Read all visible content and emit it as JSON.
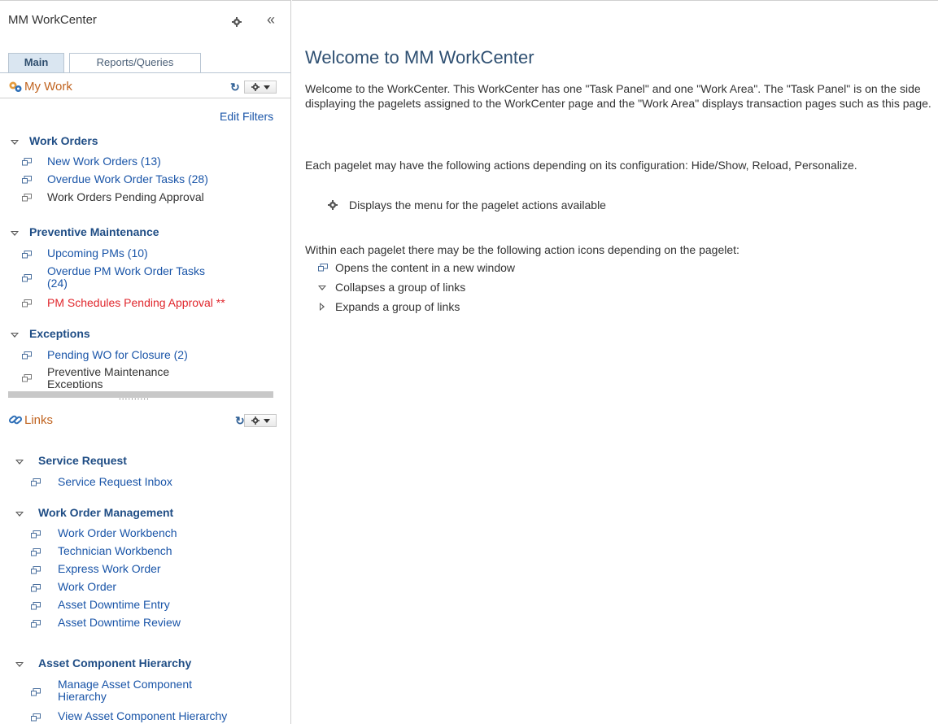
{
  "panel": {
    "title": "MM WorkCenter",
    "collapse_glyph": "«",
    "tabs": [
      {
        "label": "Main",
        "active": true
      },
      {
        "label": "Reports/Queries",
        "active": false
      }
    ]
  },
  "my_work": {
    "title": "My Work",
    "refresh_glyph": "↻",
    "edit_filters": "Edit Filters",
    "groups": [
      {
        "label": "Work Orders",
        "items": [
          {
            "label": "New Work Orders (13)",
            "style": "link"
          },
          {
            "label": "Overdue Work Order Tasks (28)",
            "style": "link"
          },
          {
            "label": "Work Orders Pending Approval",
            "style": "plain"
          }
        ]
      },
      {
        "label": "Preventive Maintenance",
        "items": [
          {
            "label": "Upcoming PMs (10)",
            "style": "link"
          },
          {
            "label": "Overdue PM Work Order Tasks",
            "label2": "(24)",
            "style": "link"
          },
          {
            "label": "PM Schedules Pending Approval **",
            "style": "alert"
          }
        ]
      },
      {
        "label": "Exceptions",
        "items": [
          {
            "label": "Pending WO for Closure (2)",
            "style": "link"
          },
          {
            "label": "Preventive Maintenance",
            "label2": "Exceptions",
            "style": "plain"
          }
        ]
      }
    ]
  },
  "links": {
    "title": "Links",
    "refresh_glyph": "↻",
    "groups": [
      {
        "label": "Service Request",
        "items": [
          "Service Request Inbox"
        ]
      },
      {
        "label": "Work Order Management",
        "items": [
          "Work Order Workbench",
          "Technician Workbench",
          "Express Work Order",
          "Work Order",
          "Asset Downtime Entry",
          "Asset Downtime Review"
        ]
      },
      {
        "label": "Asset Component Hierarchy",
        "items": [
          "Manage Asset Component",
          "View Asset Component Hierarchy"
        ],
        "item1_line2": "Hierarchy"
      }
    ]
  },
  "work_area": {
    "title": "Welcome to MM WorkCenter",
    "para1": "Welcome to the WorkCenter. This WorkCenter has one \"Task Panel\" and one \"Work Area\". The \"Task Panel\" is on the side displaying the pagelets assigned to the WorkCenter page and the \"Work Area\" displays transaction pages such as this page.",
    "para2": "Each pagelet may have the following actions depending on its configuration: Hide/Show, Reload, Personalize.",
    "gear_desc": "Displays the menu for the pagelet actions available",
    "para3": "Within each pagelet there may be the following action icons depending on the pagelet:",
    "icon_desc": [
      "Opens the content in a new window",
      "Collapses a group of links",
      "Expands a group of links"
    ]
  },
  "colors": {
    "link": "#1a55a8",
    "group_head": "#1f4d85",
    "pagelet_title": "#c0631f",
    "alert": "#e0262c",
    "title": "#2f5072"
  },
  "icons": [
    "gear-icon",
    "collapse-icon",
    "refresh-icon",
    "pagelet-menu-icon",
    "new-window-icon",
    "collapse-group-icon",
    "expand-group-icon",
    "my-work-icon",
    "links-icon"
  ]
}
